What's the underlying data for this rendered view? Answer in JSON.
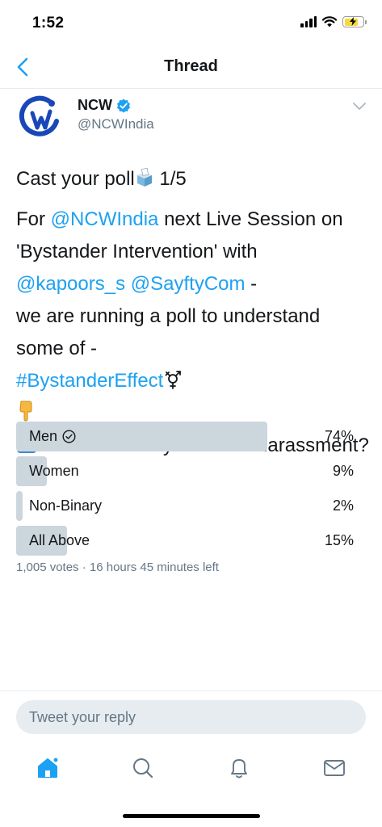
{
  "status_bar": {
    "time": "1:52"
  },
  "nav": {
    "title": "Thread"
  },
  "tweet": {
    "author_name": "NCW",
    "author_handle": "@NCWIndia",
    "line1_text": "Cast your poll",
    "line1_suffix": " 1/5",
    "para2_prefix": "For ",
    "mention_ncw": "@NCWIndia",
    "para2_middle": " next Live Session on 'Bystander Intervention' with",
    "mention_kapoors": "@kapoors_s",
    "mention_sayfty": "@SayftyCom",
    "para2_after_mentions": " -",
    "para2_line": "we are running a poll to understand some of -",
    "hashtag": "#BystanderEffect",
    "question_suffix": ". Who is usually at risk of harassment?"
  },
  "poll": {
    "options": [
      {
        "label": "Men",
        "percent": "74%",
        "fraction": 0.74,
        "winner": true
      },
      {
        "label": "Women",
        "percent": "9%",
        "fraction": 0.09,
        "winner": false
      },
      {
        "label": "Non-Binary",
        "percent": "2%",
        "fraction": 0.02,
        "winner": false
      },
      {
        "label": "All Above",
        "percent": "15%",
        "fraction": 0.15,
        "winner": false
      }
    ],
    "meta": "1,005 votes · 16 hours 45 minutes left"
  },
  "reply": {
    "placeholder": "Tweet your reply"
  },
  "tabs": [
    {
      "name": "tab-home",
      "icon": "home-icon",
      "active": true
    },
    {
      "name": "tab-search",
      "icon": "search-icon",
      "active": false
    },
    {
      "name": "tab-notifications",
      "icon": "bell-icon",
      "active": false
    },
    {
      "name": "tab-messages",
      "icon": "mail-icon",
      "active": false
    }
  ],
  "colors": {
    "accent": "#1da1f2",
    "poll_fill": "#ccd6dd",
    "secondary_text": "#657786"
  }
}
